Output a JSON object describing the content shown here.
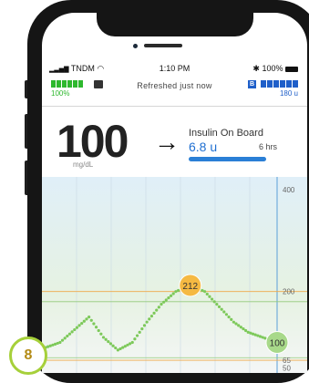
{
  "status": {
    "carrier": "TNDM",
    "time": "1:10 PM",
    "battery": "100%"
  },
  "pump": {
    "battery_label": "100%",
    "refreshed": "Refreshed just now",
    "insulin_badge": "B",
    "insulin_label": "180 u"
  },
  "glucose": {
    "value": "100",
    "unit": "mg/dL",
    "trend_arrow": "→"
  },
  "iob": {
    "title": "Insulin On Board",
    "value": "6.8 u",
    "hours": "6 hrs",
    "level": 1.0
  },
  "chart_data": {
    "type": "line",
    "ylim": [
      40,
      400
    ],
    "y_ticks": [
      "400",
      "200",
      "65",
      "50"
    ],
    "target_lines": [
      65,
      200
    ],
    "series": [
      {
        "values": [
          90,
          100,
          125,
          150,
          110,
          85,
          100,
          140,
          175,
          200,
          212,
          200,
          170,
          140,
          120,
          110,
          100
        ],
        "color": "#7dc95a"
      }
    ],
    "labels": [
      {
        "text": "212",
        "value": 212,
        "index": 10
      },
      {
        "text": "100",
        "value": 100,
        "index": 16
      }
    ]
  },
  "tutorial_step": "8",
  "colors": {
    "battery_green": "#2eb82e",
    "insulin_blue": "#1f5fc9",
    "trace_green": "#7dc95a",
    "high_line": "#f0a848",
    "peak_badge": "#f5b942"
  }
}
